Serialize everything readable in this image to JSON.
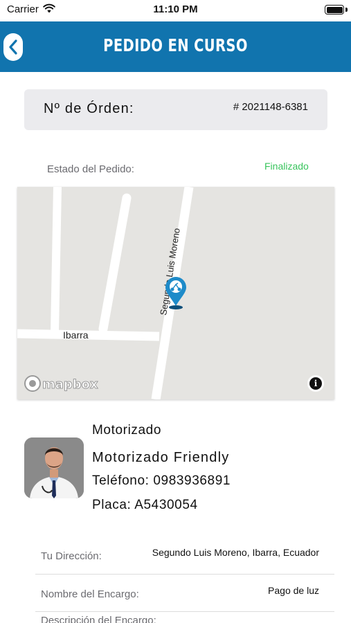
{
  "status_bar": {
    "carrier": "Carrier",
    "time": "11:10 PM",
    "battery_level": 1.0
  },
  "nav": {
    "title": "PEDIDO EN CURSO",
    "back_icon": "chevron-left-icon"
  },
  "order": {
    "label": "Nº de Órden:",
    "number": "# 2021148-6381"
  },
  "status": {
    "label": "Estado del Pedido:",
    "value": "Finalizado",
    "value_color": "#38c45c"
  },
  "map": {
    "street_vertical": "Segundo Luis Moreno",
    "street_horizontal": "Ibarra",
    "attribution": "mapbox",
    "info_icon": "info-icon",
    "marker_icon": "motorcycle-location-pin-icon"
  },
  "driver": {
    "header": "Motorizado",
    "name": "Motorizado Friendly",
    "phone": "Teléfono: 0983936891",
    "plate": "Placa: A5430054"
  },
  "details": [
    {
      "label": "Tu Dirección:",
      "value": "Segundo Luis Moreno, Ibarra, Ecuador"
    },
    {
      "label": "Nombre del Encargo:",
      "value": "Pago de luz"
    },
    {
      "label": "Descripción del Encargo:",
      "value": ""
    }
  ],
  "colors": {
    "brand": "#1174ae",
    "background": "#ffffff",
    "card": "#ebebee",
    "map": "#e5e4e1"
  }
}
